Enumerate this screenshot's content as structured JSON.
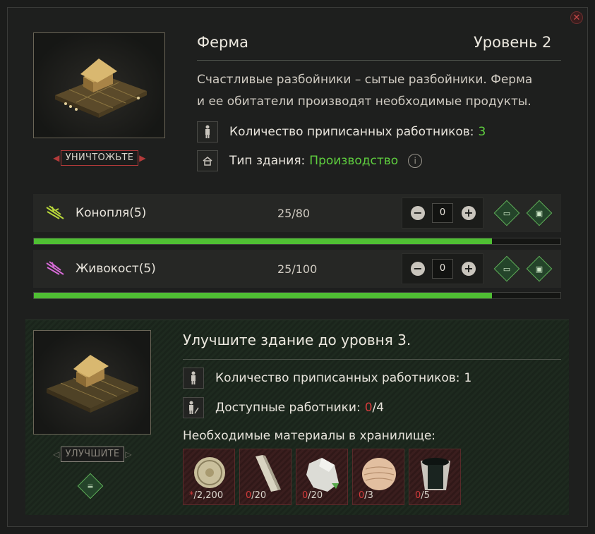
{
  "building": {
    "name": "Ферма",
    "level_label": "Уровень 2",
    "description_line1": "Счастливые разбойники – сытые разбойники. Ферма",
    "description_line2": "и ее обитатели производят необходимые продукты.",
    "workers_label": "Количество приписанных работников:",
    "workers_value": "3",
    "type_label": "Тип здания:",
    "type_value": "Производство",
    "destroy_label": "УНИЧТОЖЬТЕ"
  },
  "resources": [
    {
      "name": "Конопля",
      "count_paren": "(5)",
      "amount": "25/80",
      "stepper_value": "0",
      "progress": 0.87,
      "icon_color": "#b7d63a"
    },
    {
      "name": "Живокост",
      "count_paren": "(5)",
      "amount": "25/100",
      "stepper_value": "0",
      "progress": 0.87,
      "icon_color": "#d66bd6"
    }
  ],
  "upgrade": {
    "title": "Улучшите здание до уровня 3.",
    "workers_label": "Количество приписанных работников:",
    "workers_value": "1",
    "available_label": "Доступные работники:",
    "available_have": "0",
    "available_need": "/4",
    "materials_label": "Необходимые материалы в хранилище:",
    "button_label": "УЛУЧШИТЕ",
    "materials": [
      {
        "have": "*",
        "need": "/2,200",
        "icon": "coin-icon"
      },
      {
        "have": "0",
        "need": "/20",
        "icon": "plank-icon"
      },
      {
        "have": "0",
        "need": "/20",
        "icon": "stone-icon"
      },
      {
        "have": "0",
        "need": "/3",
        "icon": "leather-icon"
      },
      {
        "have": "0",
        "need": "/5",
        "icon": "tar-bucket-icon"
      }
    ]
  },
  "colors": {
    "accent_green": "#5fcf3f",
    "danger_red": "#d23b3b",
    "progress_fill": "#4fbf33"
  }
}
